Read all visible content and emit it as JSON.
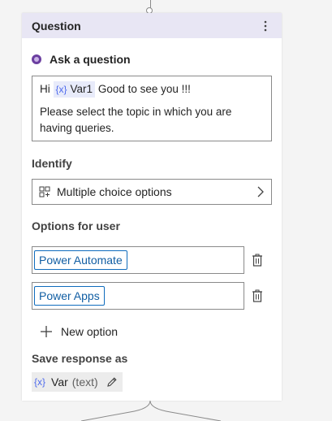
{
  "node": {
    "title": "Question",
    "ask_label": "Ask a question",
    "message": {
      "prefix": "Hi",
      "variable_icon": "{x}",
      "variable_name": "Var1",
      "suffix": "Good to see you !!!",
      "line2": "Please select the topic in which you are having queries."
    },
    "identify": {
      "label": "Identify",
      "value": "Multiple choice options"
    },
    "options": {
      "label": "Options for user",
      "items": [
        {
          "label": "Power Automate"
        },
        {
          "label": "Power Apps"
        }
      ],
      "new_option_label": "New option"
    },
    "save_response": {
      "label": "Save response as",
      "variable_icon": "{x}",
      "variable_name": "Var",
      "variable_type": "(text)"
    }
  },
  "colors": {
    "header_bg": "#e8e6f4",
    "accent_purple": "#6b3fa0",
    "chip_border": "#0f6cbd",
    "variable_blue": "#4f6bed"
  },
  "icons": [
    "more-vertical-icon",
    "question-icon",
    "variable-icon",
    "grid-icon",
    "chevron-right-icon",
    "trash-icon",
    "plus-icon",
    "edit-pencil-icon"
  ]
}
